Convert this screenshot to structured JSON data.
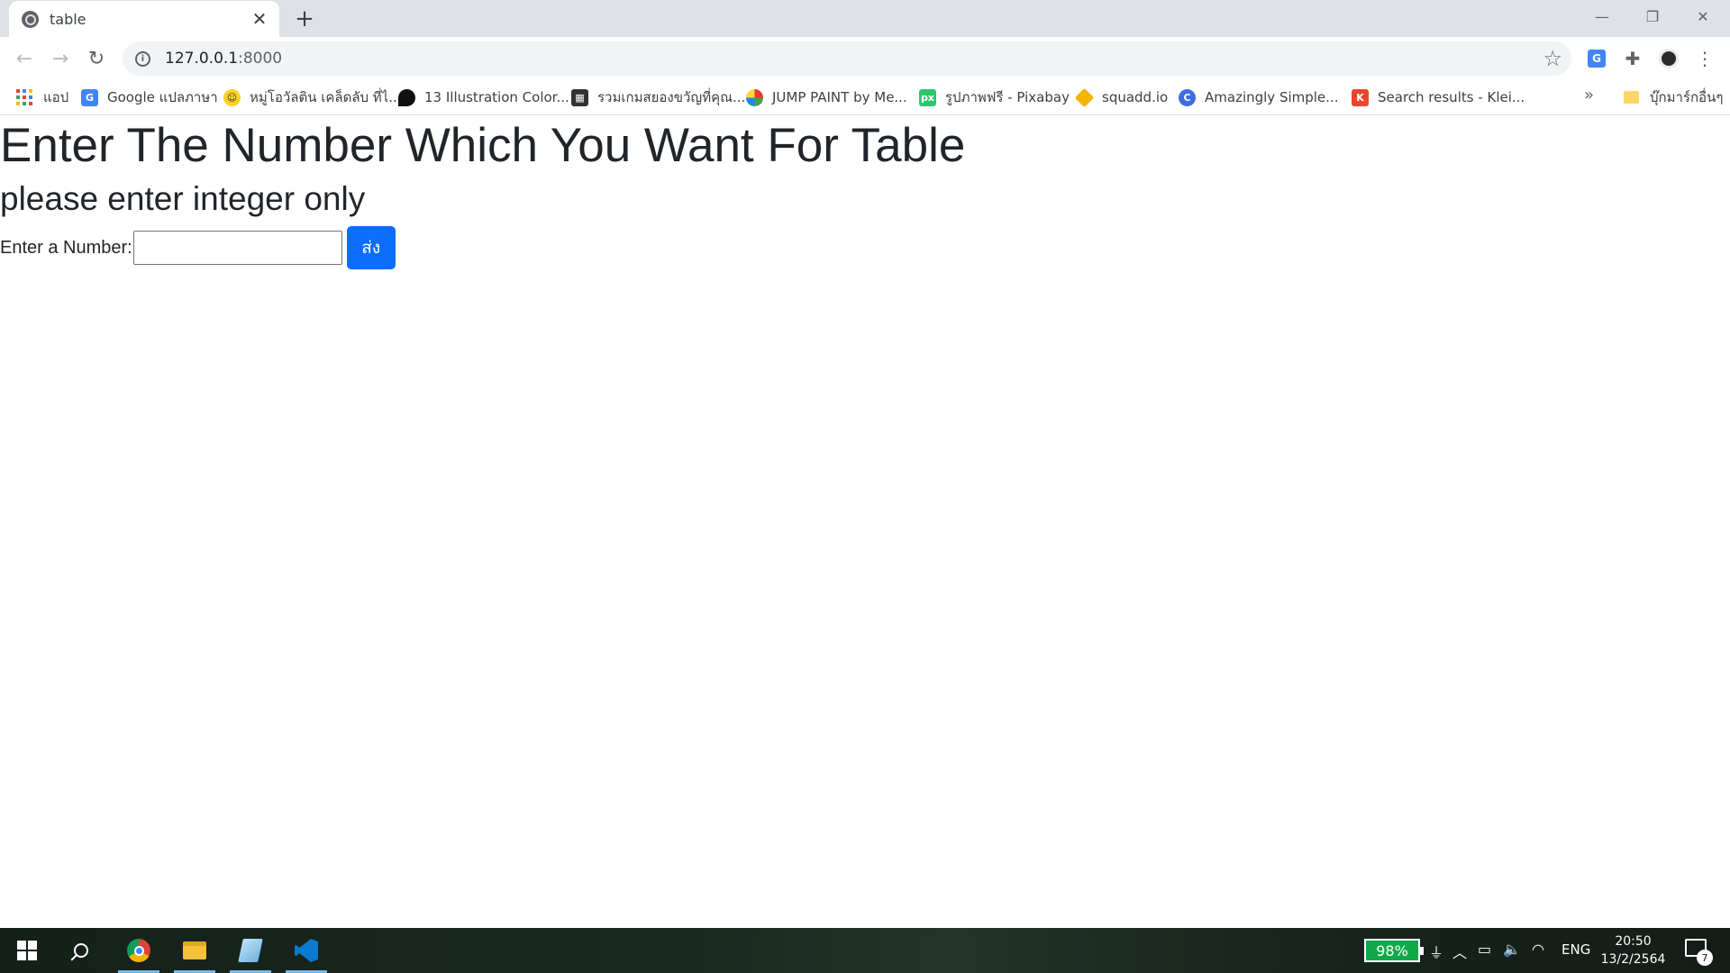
{
  "browser": {
    "tab": {
      "title": "table",
      "close_icon": "close-icon",
      "favicon": "globe-icon"
    },
    "new_tab_icon": "plus-icon",
    "window_controls": {
      "minimize": "minimize-icon",
      "restore": "restore-icon",
      "close": "close-icon"
    },
    "toolbar": {
      "back_icon": "arrow-left-icon",
      "forward_icon": "arrow-right-icon",
      "reload_icon": "reload-icon",
      "url_host": "127.0.0.1",
      "url_port": ":8000",
      "star_icon": "star-icon",
      "extensions": [
        "translate-icon",
        "puzzle-icon",
        "profile-avatar-icon",
        "kebab-menu-icon"
      ]
    },
    "bookmarks": [
      {
        "label": "แอป",
        "icon": "apps-grid-icon"
      },
      {
        "label": "Google แปลภาษา",
        "icon": "google-translate-icon"
      },
      {
        "label": "หมู่โอวัลติน เคล็ดลับ ที่ไ...",
        "icon": "emoji-icon"
      },
      {
        "label": "13 Illustration Color...",
        "icon": "pin-icon"
      },
      {
        "label": "รวมเกมสยองขวัญที่คุณ...",
        "icon": "blocks-icon"
      },
      {
        "label": "JUMP PAINT by Me...",
        "icon": "jump-paint-icon"
      },
      {
        "label": "รูปภาพฟรี - Pixabay",
        "icon": "pixabay-icon"
      },
      {
        "label": "squadd.io",
        "icon": "squadd-icon"
      },
      {
        "label": "Amazingly Simple...",
        "icon": "c-logo-icon"
      },
      {
        "label": "Search results - Klei...",
        "icon": "klei-icon"
      }
    ],
    "bookmarks_more": "»",
    "other_bookmarks": "บุ๊กมาร์กอื่นๆ"
  },
  "page": {
    "heading": "Enter The Number Which You Want For Table",
    "subheading": "please enter integer only",
    "form": {
      "label": "Enter a Number:",
      "input_value": "",
      "submit_label": "ส่ง"
    }
  },
  "colors": {
    "submit_button": "#0d6efd",
    "text": "#212529",
    "battery": "#12a84a"
  },
  "taskbar": {
    "apps": [
      "windows-start-icon",
      "search-icon",
      "chrome-icon",
      "file-explorer-icon",
      "notepad-icon",
      "vscode-icon"
    ],
    "battery": "98%",
    "language": "ENG",
    "time": "20:50",
    "date": "13/2/2564",
    "notifications": "7"
  }
}
